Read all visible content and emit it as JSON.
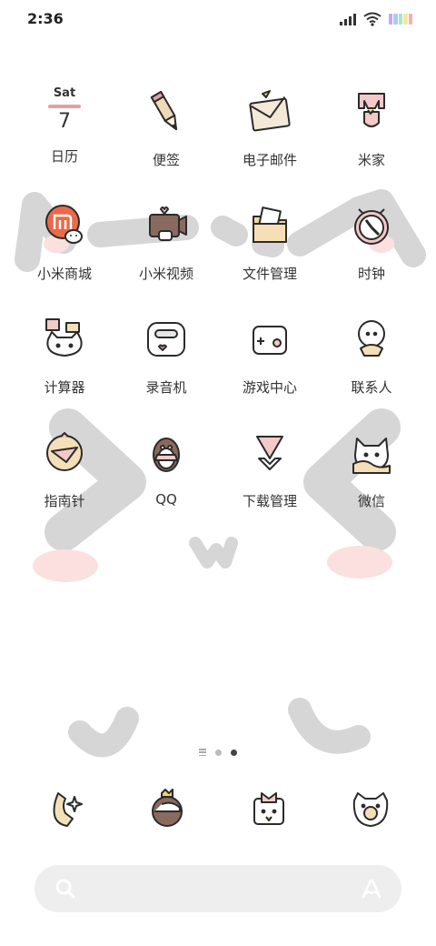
{
  "status_bar": {
    "time": "2:36"
  },
  "calendar": {
    "weekday": "Sat",
    "day": "7"
  },
  "apps": [
    {
      "label": "日历",
      "icon": "calendar-icon"
    },
    {
      "label": "便签",
      "icon": "pencil-icon"
    },
    {
      "label": "电子邮件",
      "icon": "envelope-icon"
    },
    {
      "label": "米家",
      "icon": "mijia-icon"
    },
    {
      "label": "小米商城",
      "icon": "mi-store-icon"
    },
    {
      "label": "小米视频",
      "icon": "video-icon"
    },
    {
      "label": "文件管理",
      "icon": "folder-icon"
    },
    {
      "label": "时钟",
      "icon": "clock-icon"
    },
    {
      "label": "计算器",
      "icon": "calculator-icon"
    },
    {
      "label": "录音机",
      "icon": "recorder-icon"
    },
    {
      "label": "游戏中心",
      "icon": "gamepad-icon"
    },
    {
      "label": "联系人",
      "icon": "contacts-icon"
    },
    {
      "label": "指南针",
      "icon": "compass-icon"
    },
    {
      "label": "QQ",
      "icon": "qq-penguin-icon"
    },
    {
      "label": "下载管理",
      "icon": "download-icon"
    },
    {
      "label": "微信",
      "icon": "wechat-cat-icon"
    }
  ],
  "dock": [
    {
      "icon": "phone-icon"
    },
    {
      "icon": "browser-icon"
    },
    {
      "icon": "gift-messages-icon"
    },
    {
      "icon": "camera-icon"
    }
  ],
  "colors": {
    "wallpaper_gray": "#d6d6d6",
    "blush_pink": "#fbe0df",
    "icon_outline": "#2b2b2b",
    "accent_pink": "#e2a1a0"
  }
}
